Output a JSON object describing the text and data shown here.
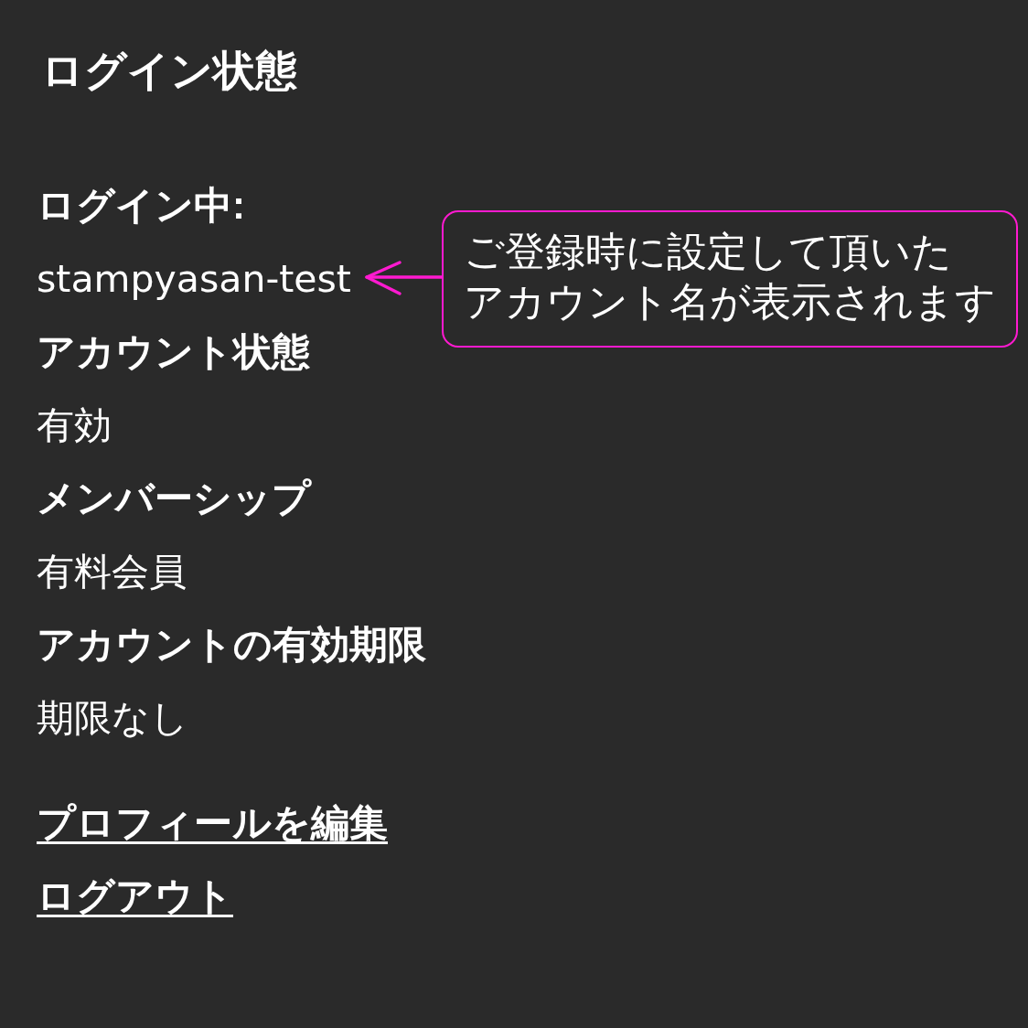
{
  "title": "ログイン状態",
  "fields": [
    {
      "label": "ログイン中:",
      "value": "stampyasan-test"
    },
    {
      "label": "アカウント状態",
      "value": "有効"
    },
    {
      "label": "メンバーシップ",
      "value": "有料会員"
    },
    {
      "label": "アカウントの有効期限",
      "value": "期限なし"
    }
  ],
  "links": [
    "プロフィールを編集",
    "ログアウト"
  ],
  "annotation": {
    "lines": [
      "ご登録時に設定して頂いた",
      "アカウント名が表示されます"
    ]
  }
}
